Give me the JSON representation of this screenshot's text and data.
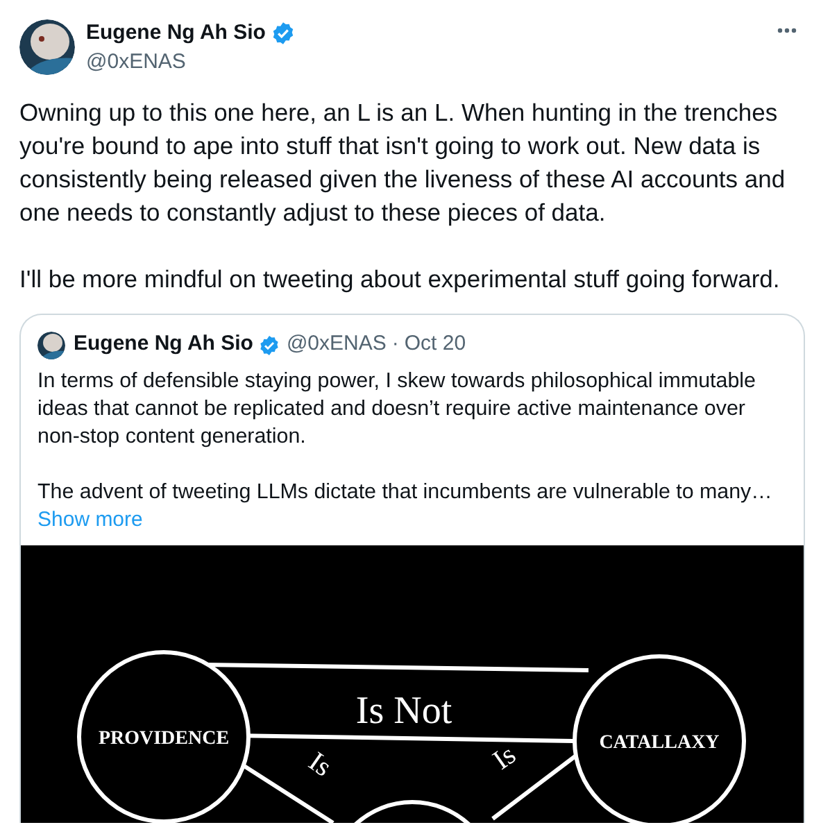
{
  "author": {
    "name": "Eugene Ng Ah Sio",
    "verified": true,
    "handle": "@0xENAS"
  },
  "post": {
    "paragraphs": [
      "Owning up to this one here, an L is an L. When hunting in the trenches you're bound to ape into stuff that isn't going to work out. New data is consistently being released given the liveness of these AI accounts and one needs to constantly adjust to these pieces of data.",
      "I'll be more mindful on tweeting about experimental stuff going forward."
    ]
  },
  "quote": {
    "author": {
      "name": "Eugene Ng Ah Sio",
      "verified": true,
      "handle": "@0xENAS",
      "separator": "·",
      "date": "Oct 20"
    },
    "paragraphs": [
      "In terms of defensible staying power, I skew towards philosophical immutable ideas that cannot be replicated and doesn’t require active maintenance over non-stop content generation.",
      "The advent of tweeting LLMs dictate that incumbents are vulnerable to many…"
    ],
    "show_more": "Show more",
    "diagram": {
      "nodes": [
        "PROVIDENCE",
        "CATALLAXY"
      ],
      "edge_labels": [
        "Is Not",
        "Is",
        "Is"
      ]
    }
  }
}
